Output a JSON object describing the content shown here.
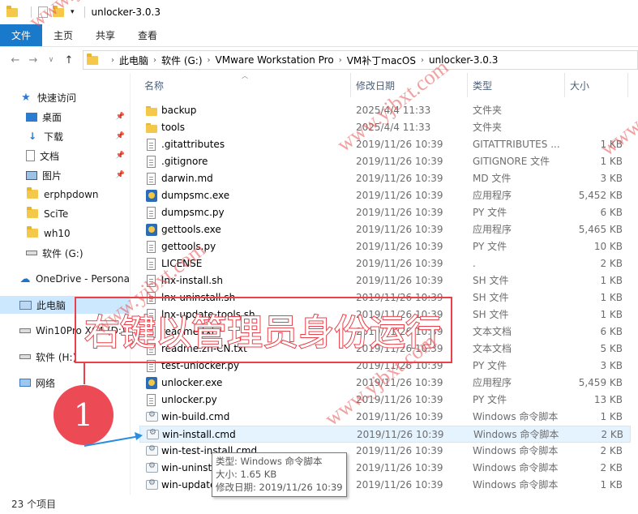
{
  "window": {
    "title": "unlocker-3.0.3"
  },
  "ribbon": {
    "tabs": [
      "文件",
      "主页",
      "共享",
      "查看"
    ]
  },
  "address": {
    "crumbs": [
      "此电脑",
      "软件 (G:)",
      "VMware Workstation Pro",
      "VM补丁macOS",
      "unlocker-3.0.3"
    ]
  },
  "nav": {
    "items": [
      {
        "label": "快速访问",
        "icon": "star-icon"
      },
      {
        "label": "桌面",
        "icon": "desktop-icon",
        "pinned": true
      },
      {
        "label": "下载",
        "icon": "download-icon",
        "pinned": true
      },
      {
        "label": "文档",
        "icon": "document-icon",
        "pinned": true
      },
      {
        "label": "图片",
        "icon": "picture-icon",
        "pinned": true
      },
      {
        "label": "erphpdown",
        "icon": "folder-icon"
      },
      {
        "label": "SciTe",
        "icon": "folder-icon"
      },
      {
        "label": "wh10",
        "icon": "folder-icon"
      },
      {
        "label": "软件 (G:)",
        "icon": "drive-icon"
      },
      {
        "label": "OneDrive - Persona",
        "icon": "cloud-icon"
      },
      {
        "label": "此电脑",
        "icon": "computer-icon"
      },
      {
        "label": "Win10Pro X64 (D:)",
        "icon": "drive-icon"
      },
      {
        "label": "软件 (H:)",
        "icon": "drive-icon"
      },
      {
        "label": "网络",
        "icon": "network-icon"
      }
    ]
  },
  "columns": {
    "name": "名称",
    "date": "修改日期",
    "type": "类型",
    "size": "大小"
  },
  "files": [
    {
      "name": "backup",
      "date": "2025/4/4 11:33",
      "type": "文件夹",
      "size": "",
      "icon": "folder"
    },
    {
      "name": "tools",
      "date": "2025/4/4 11:33",
      "type": "文件夹",
      "size": "",
      "icon": "folder"
    },
    {
      "name": ".gitattributes",
      "date": "2019/11/26 10:39",
      "type": "GITATTRIBUTES ...",
      "size": "1 KB",
      "icon": "doc"
    },
    {
      "name": ".gitignore",
      "date": "2019/11/26 10:39",
      "type": "GITIGNORE 文件",
      "size": "1 KB",
      "icon": "doc"
    },
    {
      "name": "darwin.md",
      "date": "2019/11/26 10:39",
      "type": "MD 文件",
      "size": "3 KB",
      "icon": "doc"
    },
    {
      "name": "dumpsmc.exe",
      "date": "2019/11/26 10:39",
      "type": "应用程序",
      "size": "5,452 KB",
      "icon": "exe"
    },
    {
      "name": "dumpsmc.py",
      "date": "2019/11/26 10:39",
      "type": "PY 文件",
      "size": "6 KB",
      "icon": "doc"
    },
    {
      "name": "gettools.exe",
      "date": "2019/11/26 10:39",
      "type": "应用程序",
      "size": "5,465 KB",
      "icon": "exe"
    },
    {
      "name": "gettools.py",
      "date": "2019/11/26 10:39",
      "type": "PY 文件",
      "size": "10 KB",
      "icon": "doc"
    },
    {
      "name": "LICENSE",
      "date": "2019/11/26 10:39",
      "type": ".",
      "size": "2 KB",
      "icon": "doc"
    },
    {
      "name": "lnx-install.sh",
      "date": "2019/11/26 10:39",
      "type": "SH 文件",
      "size": "1 KB",
      "icon": "doc"
    },
    {
      "name": "lnx-uninstall.sh",
      "date": "2019/11/26 10:39",
      "type": "SH 文件",
      "size": "1 KB",
      "icon": "doc"
    },
    {
      "name": "lnx-update-tools.sh",
      "date": "2019/11/26 10:39",
      "type": "SH 文件",
      "size": "1 KB",
      "icon": "doc"
    },
    {
      "name": "readme.txt",
      "date": "2019/11/26 10:39",
      "type": "文本文档",
      "size": "6 KB",
      "icon": "doc"
    },
    {
      "name": "readme.zh-CN.txt",
      "date": "2019/11/26 10:39",
      "type": "文本文档",
      "size": "5 KB",
      "icon": "doc"
    },
    {
      "name": "test-unlocker.py",
      "date": "2019/11/26 10:39",
      "type": "PY 文件",
      "size": "3 KB",
      "icon": "doc"
    },
    {
      "name": "unlocker.exe",
      "date": "2019/11/26 10:39",
      "type": "应用程序",
      "size": "5,459 KB",
      "icon": "exe"
    },
    {
      "name": "unlocker.py",
      "date": "2019/11/26 10:39",
      "type": "PY 文件",
      "size": "13 KB",
      "icon": "doc"
    },
    {
      "name": "win-build.cmd",
      "date": "2019/11/26 10:39",
      "type": "Windows 命令脚本",
      "size": "1 KB",
      "icon": "cmd"
    },
    {
      "name": "win-install.cmd",
      "date": "2019/11/26 10:39",
      "type": "Windows 命令脚本",
      "size": "2 KB",
      "icon": "cmd",
      "selected": true
    },
    {
      "name": "win-test-install.cmd",
      "date": "2019/11/26 10:39",
      "type": "Windows 命令脚本",
      "size": "2 KB",
      "icon": "cmd"
    },
    {
      "name": "win-uninstall.cmd",
      "date": "2019/11/26 10:39",
      "type": "Windows 命令脚本",
      "size": "2 KB",
      "icon": "cmd"
    },
    {
      "name": "win-update-tools.cmd",
      "date": "2019/11/26 10:39",
      "type": "Windows 命令脚本",
      "size": "1 KB",
      "icon": "cmd"
    }
  ],
  "status": {
    "item_count": "23 个项目"
  },
  "tooltip": {
    "type_line": "类型: Windows 命令脚本",
    "size_line": "大小: 1.65 KB",
    "date_line": "修改日期: 2019/11/26 10:39"
  },
  "annotation": {
    "callout_text": "右键以管理员身份运行",
    "step_number": "1",
    "color": "#e8414a"
  },
  "watermark": {
    "text": "www.yjbxt.com"
  },
  "colors": {
    "file_tab": "#1979ca",
    "selection": "#cce8ff",
    "folder": "#f4c84a"
  }
}
